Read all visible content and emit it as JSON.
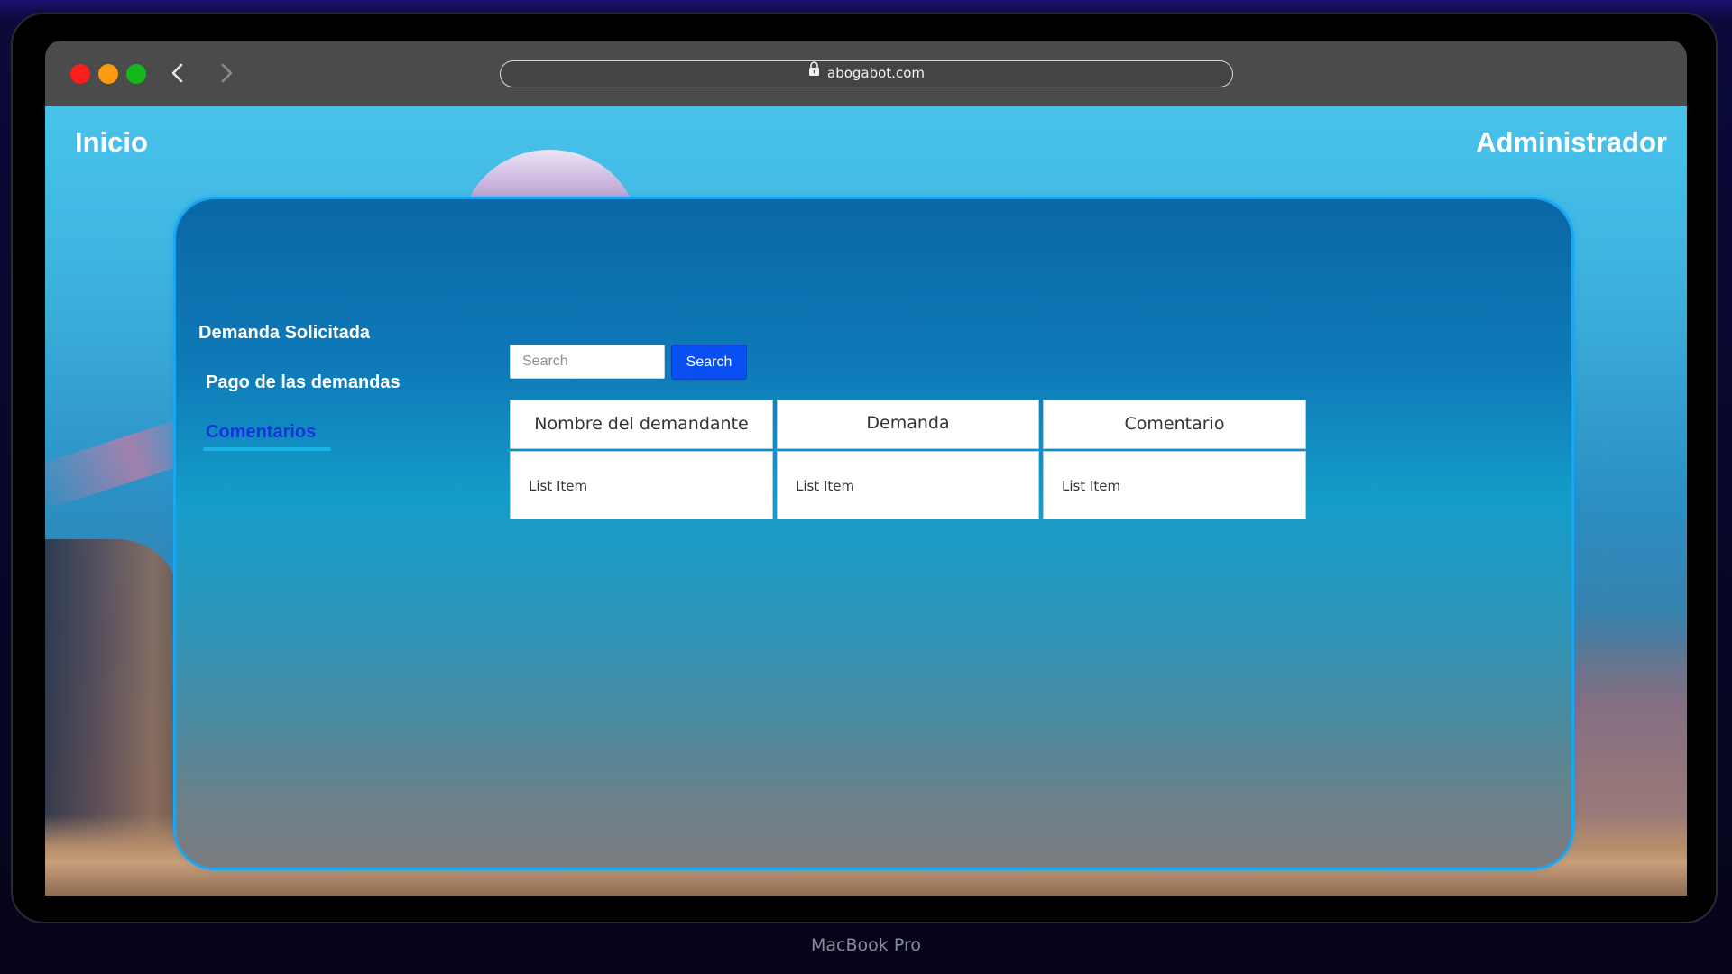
{
  "browser": {
    "url": "abogabot.com"
  },
  "device": {
    "label": "MacBook Pro"
  },
  "header": {
    "home_label": "Inicio",
    "admin_label": "Administrador"
  },
  "sidebar": {
    "items": [
      {
        "label": "Demanda Solicitada",
        "active": false
      },
      {
        "label": "Pago de las demandas",
        "active": false
      },
      {
        "label": "Comentarios",
        "active": true
      }
    ]
  },
  "search": {
    "placeholder": "Search",
    "value": "",
    "button_label": "Search"
  },
  "table": {
    "columns": [
      "Nombre del demandante",
      "Demanda",
      "Comentario"
    ],
    "rows": [
      [
        "List Item",
        "List Item",
        "List Item"
      ]
    ]
  },
  "colors": {
    "active_link": "#1434d8",
    "search_button": "#0a4ff2",
    "card_border": "#1aa6f0"
  }
}
